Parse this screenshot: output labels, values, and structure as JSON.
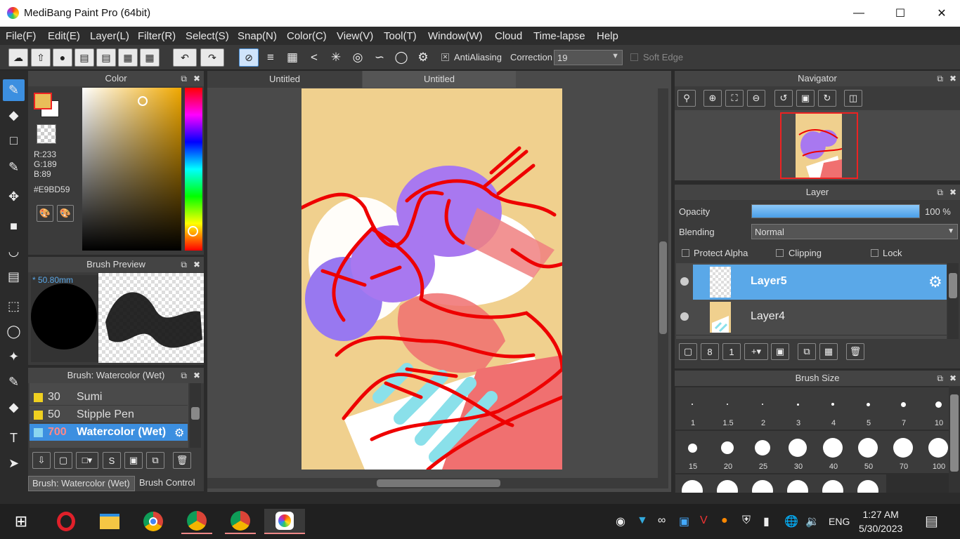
{
  "window": {
    "title": "MediBang Paint Pro (64bit)"
  },
  "menu": [
    "File(F)",
    "Edit(E)",
    "Layer(L)",
    "Filter(R)",
    "Select(S)",
    "Snap(N)",
    "Color(C)",
    "View(V)",
    "Tool(T)",
    "Window(W)",
    "Cloud",
    "Time-lapse",
    "Help"
  ],
  "toolbar": {
    "antialiasing_label": "AntiAliasing",
    "correction_label": "Correction",
    "correction_value": "19",
    "soft_edge_label": "Soft Edge"
  },
  "color_panel": {
    "title": "Color",
    "r": "R:233",
    "g": "G:189",
    "b": "B:89",
    "hex": "#E9BD59",
    "fg_color": "#E9BD59"
  },
  "brush_preview": {
    "title": "Brush Preview",
    "size": "* 50.80mm"
  },
  "brush_panel": {
    "title": "Brush: Watercolor (Wet)",
    "items": [
      {
        "size": "30",
        "name": "Sumi",
        "color": "#f0d020"
      },
      {
        "size": "50",
        "name": "Stipple Pen",
        "color": "#f0d020"
      },
      {
        "size": "700",
        "name": "Watercolor (Wet)",
        "color": "#8ad6f0"
      }
    ],
    "tab_brush": "Brush: Watercolor (Wet)",
    "tab_control": "Brush Control"
  },
  "canvas": {
    "tabs": [
      "Untitled",
      "Untitled"
    ]
  },
  "navigator": {
    "title": "Navigator"
  },
  "layer_panel": {
    "title": "Layer",
    "opacity_label": "Opacity",
    "opacity_value": "100 %",
    "opacity_fraction": 1.0,
    "blending_label": "Blending",
    "blending_value": "Normal",
    "protect_alpha": "Protect Alpha",
    "clipping": "Clipping",
    "lock": "Lock",
    "layers": [
      {
        "name": "Layer5",
        "selected": true
      },
      {
        "name": "Layer4",
        "selected": false
      }
    ]
  },
  "brush_size": {
    "title": "Brush Size",
    "sizes": [
      "1",
      "1.5",
      "2",
      "3",
      "4",
      "5",
      "7",
      "10",
      "15",
      "20",
      "25",
      "30",
      "40",
      "50",
      "70",
      "100"
    ]
  },
  "taskbar": {
    "lang": "ENG",
    "time": "1:27 AM",
    "date": "5/30/2023"
  }
}
